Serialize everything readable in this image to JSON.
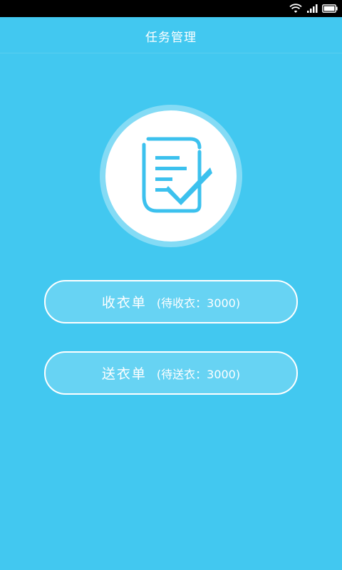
{
  "status_bar": {
    "icons": [
      "wifi-icon",
      "signal-icon",
      "battery-icon"
    ]
  },
  "header": {
    "title": "任务管理"
  },
  "hero": {
    "icon": "document-check-icon"
  },
  "buttons": {
    "receive": {
      "label": "收衣单",
      "count_text": "(待收衣：3000)"
    },
    "send": {
      "label": "送衣单",
      "count_text": "(待送衣：3000)"
    }
  },
  "colors": {
    "background": "#42c8f0",
    "accent": "#3cc1ee",
    "white": "#ffffff"
  }
}
